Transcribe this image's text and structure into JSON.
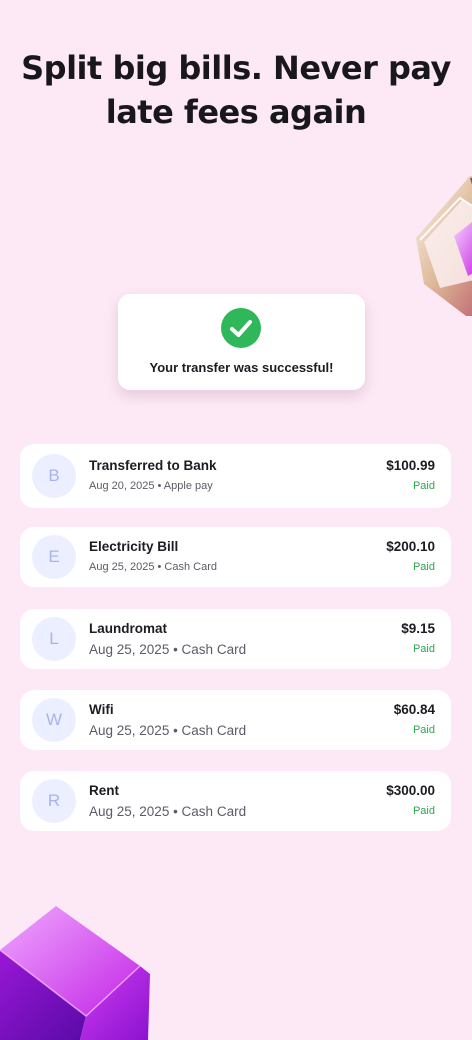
{
  "headline": {
    "line1": "Split big bills. Never pay",
    "line2": "late fees again"
  },
  "success": {
    "icon": "check-icon",
    "message": "Your transfer was successful!",
    "color": "#2fb75a"
  },
  "transactions": [
    {
      "initial": "B",
      "title": "Transferred to Bank",
      "subtitle": "Aug 20, 2025 • Apple pay",
      "amount": "$100.99",
      "status": "Paid"
    },
    {
      "initial": "E",
      "title": "Electricity Bill",
      "subtitle": "Aug 25, 2025 • Cash Card",
      "amount": "$200.10",
      "status": "Paid"
    },
    {
      "initial": "L",
      "title": "Laundromat",
      "subtitle": "Aug 25, 2025 • Cash Card",
      "amount": "$9.15",
      "status": "Paid"
    },
    {
      "initial": "W",
      "title": "Wifi",
      "subtitle": "Aug 25, 2025 • Cash Card",
      "amount": "$60.84",
      "status": "Paid"
    },
    {
      "initial": "R",
      "title": "Rent",
      "subtitle": "Aug 25, 2025 • Cash Card",
      "amount": "$300.00",
      "status": "Paid"
    }
  ],
  "colors": {
    "background": "#fde9f6",
    "paid": "#29a84e",
    "avatar_bg": "#ecefff",
    "avatar_text": "#a8b3ec"
  }
}
